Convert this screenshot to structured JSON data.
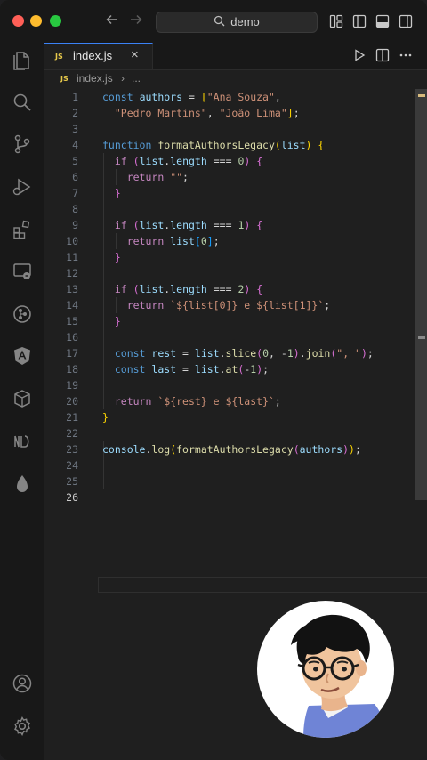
{
  "titlebar": {
    "search_text": "demo",
    "back_icon": "arrow-left-icon",
    "forward_icon": "arrow-right-icon"
  },
  "tab": {
    "badge": "JS",
    "label": "index.js",
    "close": "×"
  },
  "breadcrumb": {
    "badge": "JS",
    "file": "index.js",
    "sep": "›",
    "rest": "..."
  },
  "activity_icons": [
    "files-icon",
    "search-icon",
    "source-control-icon",
    "run-debug-icon",
    "extensions-icon",
    "remote-explorer-icon",
    "gitlens-icon",
    "angular-icon",
    "containers-icon",
    "json-icon",
    "liveshare-icon",
    "account-icon",
    "settings-gear-icon"
  ],
  "editor": {
    "current_line": 26,
    "lines": [
      {
        "n": "1",
        "code": "const authors = [\"Ana Souza\","
      },
      {
        "n": "2",
        "code": "  \"Pedro Martins\", \"João Lima\"];"
      },
      {
        "n": "3",
        "code": ""
      },
      {
        "n": "4",
        "code": "function formatAuthorsLegacy(list) {"
      },
      {
        "n": "5",
        "code": "  if (list.length === 0) {"
      },
      {
        "n": "6",
        "code": "    return \"\";"
      },
      {
        "n": "7",
        "code": "  }"
      },
      {
        "n": "8",
        "code": ""
      },
      {
        "n": "9",
        "code": "  if (list.length === 1) {"
      },
      {
        "n": "10",
        "code": "    return list[0];"
      },
      {
        "n": "11",
        "code": "  }"
      },
      {
        "n": "12",
        "code": ""
      },
      {
        "n": "13",
        "code": "  if (list.length === 2) {"
      },
      {
        "n": "14",
        "code": "    return `${list[0]} e ${list[1]}`;"
      },
      {
        "n": "15",
        "code": "  }"
      },
      {
        "n": "16",
        "code": ""
      },
      {
        "n": "17",
        "code": "  const rest = list.slice(0, -1).join(\", \");"
      },
      {
        "n": "18",
        "code": "  const last = list.at(-1);"
      },
      {
        "n": "19",
        "code": ""
      },
      {
        "n": "20",
        "code": "  return `${rest} e ${last}`;"
      },
      {
        "n": "21",
        "code": "}"
      },
      {
        "n": "22",
        "code": ""
      },
      {
        "n": "23",
        "code": "console.log(formatAuthorsLegacy(authors));"
      },
      {
        "n": "24",
        "code": ""
      },
      {
        "n": "25",
        "code": ""
      },
      {
        "n": "26",
        "code": ""
      }
    ]
  },
  "colors": {
    "keyword": "#569cd6",
    "control": "#c586c0",
    "variable": "#9cdcfe",
    "string": "#ce9178",
    "function": "#dcdcaa",
    "number": "#b5cea8"
  }
}
